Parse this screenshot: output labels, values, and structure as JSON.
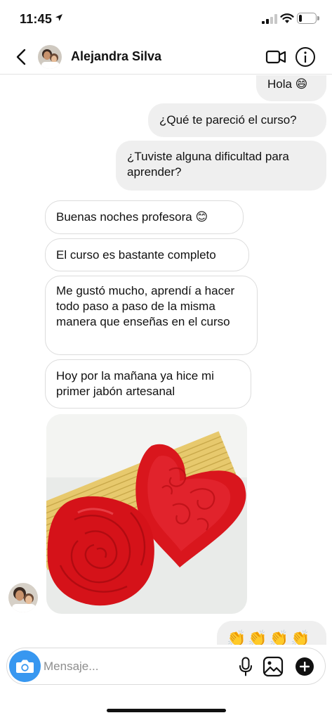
{
  "status_bar": {
    "time": "11:45",
    "battery_level": 0.2,
    "signal_bars": 2
  },
  "header": {
    "contact_name": "Alejandra Silva",
    "icons": [
      "chevron-left-icon",
      "video-camera-icon",
      "info-icon"
    ]
  },
  "messages": {
    "outgoing": [
      {
        "text": "Hola 😄"
      },
      {
        "text": "¿Qué te pareció el curso?"
      },
      {
        "text": "¿Tuviste alguna dificultad para aprender?"
      }
    ],
    "incoming": [
      {
        "text": "Buenas noches profesora 😊"
      },
      {
        "text": "El curso es bastante completo"
      },
      {
        "text": "Me gustó mucho, aprendí a hacer todo paso a paso de la misma manera que enseñas en el curso"
      },
      {
        "text": "Hoy por la mañana ya hice mi primer jabón artesanal"
      }
    ],
    "last_outgoing_emoji": "👏👏👏👏👏"
  },
  "composer": {
    "placeholder": "Mensaje...",
    "value": ""
  },
  "colors": {
    "accent": "#3797f0",
    "outgoing_bubble": "#efefef",
    "incoming_border": "#dcdcdc",
    "soap_red": "#e11b22"
  }
}
